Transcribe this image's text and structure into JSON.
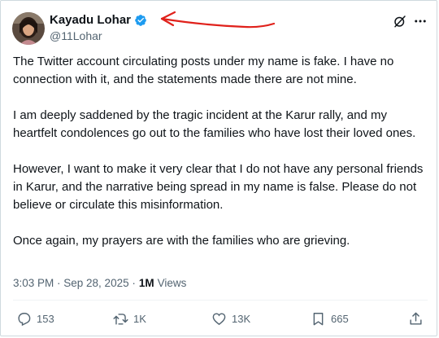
{
  "author": {
    "display_name": "Kayadu Lohar",
    "handle": "@11Lohar",
    "verified": true
  },
  "tweet": {
    "paragraphs": [
      "The Twitter account circulating posts under my name is fake. I have no connection with it, and the statements made there are not mine.",
      "I am deeply saddened by the tragic incident at the Karur rally, and my heartfelt condolences go out to the families who have lost their loved ones.",
      "However, I want to make it very clear that I do not have any personal friends in Karur, and the narrative being spread in my name is false. Please do not believe or circulate this misinformation.",
      "Once again, my prayers are with the families who are grieving."
    ],
    "timestamp": "3:03 PM · Sep 28, 2025 ·",
    "views_count": "1M",
    "views_label": "Views"
  },
  "actions": {
    "replies": "153",
    "reposts": "1K",
    "likes": "13K",
    "bookmarks": "665"
  },
  "colors": {
    "text": "#0f1419",
    "secondary": "#536471",
    "verified": "#1d9bf0",
    "annotation": "#e0211b",
    "border": "#cfd9de"
  },
  "icons": {
    "verified": "verified-badge-icon",
    "grok": "grok-icon",
    "more": "more-icon",
    "reply": "reply-icon",
    "repost": "repost-icon",
    "like": "heart-icon",
    "bookmark": "bookmark-icon",
    "share": "share-icon"
  }
}
